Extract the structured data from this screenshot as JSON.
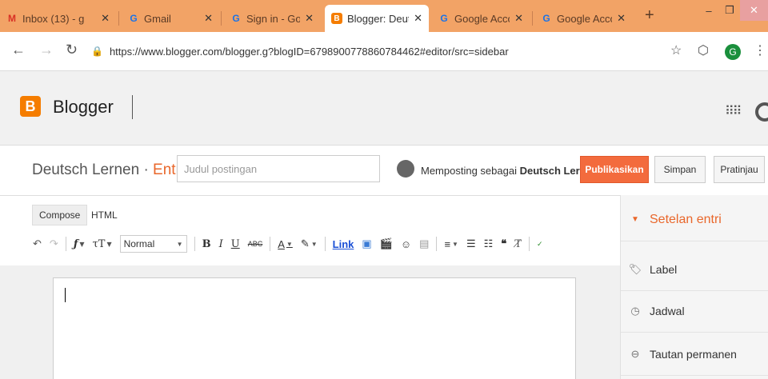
{
  "tabs": [
    {
      "title": "Inbox (13) - g",
      "favicon": "gmail-icon"
    },
    {
      "title": "Gmail",
      "favicon": "google-icon"
    },
    {
      "title": "Sign in - Goo",
      "favicon": "google-icon"
    },
    {
      "title": "Blogger: Deut",
      "favicon": "blogger-icon",
      "active": true
    },
    {
      "title": "Google Acco",
      "favicon": "google-icon"
    },
    {
      "title": "Google Acco",
      "favicon": "google-icon"
    }
  ],
  "address": {
    "url": "https://www.blogger.com/blogger.g?blogID=6798900778860784462#editor/src=sidebar",
    "profile_initial": "G"
  },
  "app": {
    "name": "Blogger",
    "logo_letter": "B",
    "accent": "#f57d00"
  },
  "post": {
    "blog_name": "Deutsch Lernen",
    "separator": "·",
    "mode_label": "Entri",
    "title_placeholder": "Judul postingan",
    "posting_as_prefix": "Memposting sebagai",
    "posting_as_name": "Deutsch Lernen!",
    "publish_label": "Publikasikan",
    "save_label": "Simpan",
    "preview_label": "Pratinjau"
  },
  "editor": {
    "compose_label": "Compose",
    "html_label": "HTML",
    "font_size_value": "Normal",
    "link_label": "Link"
  },
  "sidebar": {
    "header": "Setelan entri",
    "items": [
      {
        "label": "Label",
        "icon": "tag-icon"
      },
      {
        "label": "Jadwal",
        "icon": "clock-icon"
      },
      {
        "label": "Tautan permanen",
        "icon": "link-icon"
      }
    ]
  }
}
